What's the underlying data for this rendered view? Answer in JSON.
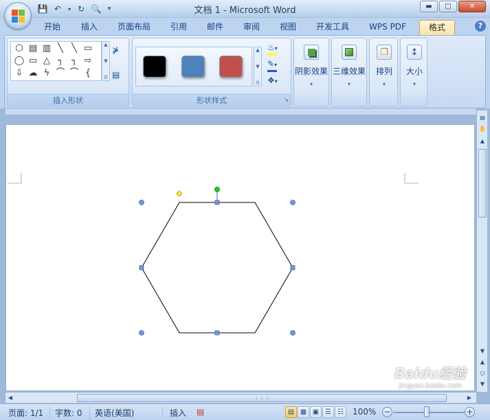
{
  "window": {
    "title": "文档 1 - Microsoft Word",
    "minimize_icon": "minimize-icon",
    "maximize_icon": "maximize-icon",
    "close_icon": "close-icon"
  },
  "quick_access": {
    "save_icon": "save-icon",
    "undo_icon": "undo-icon",
    "redo_icon": "redo-icon",
    "print_preview_icon": "print-preview-icon",
    "customize_icon": "customize-qat-icon"
  },
  "tabs": [
    {
      "label": "开始",
      "active": false
    },
    {
      "label": "插入",
      "active": false
    },
    {
      "label": "页面布局",
      "active": false
    },
    {
      "label": "引用",
      "active": false
    },
    {
      "label": "邮件",
      "active": false
    },
    {
      "label": "审阅",
      "active": false
    },
    {
      "label": "视图",
      "active": false
    },
    {
      "label": "开发工具",
      "active": false
    },
    {
      "label": "WPS PDF",
      "active": false
    },
    {
      "label": "格式",
      "active": true
    }
  ],
  "ribbon": {
    "insert_shapes": {
      "label": "插入形状",
      "shapes": [
        "⬡",
        "▤",
        "▥",
        "╲",
        "╲",
        "▭",
        "◯",
        "▭",
        "△",
        "┐",
        "┐",
        "⇨",
        "⇩",
        "☁",
        "ϟ",
        "⌒",
        "⌒",
        "{"
      ]
    },
    "shape_styles": {
      "label": "形状样式",
      "swatches": [
        "#000000",
        "#4f81bd",
        "#c0504d"
      ],
      "fill_icon": "fill-icon",
      "outline_icon": "outline-icon",
      "change_shape_icon": "change-shape-icon",
      "accent_fill": "#ffff00",
      "accent_outline": "#2b50d8"
    },
    "buttons": {
      "shadow_effects": "阴影效果",
      "three_d_effects": "三维效果",
      "arrange": "排列",
      "size": "大小"
    }
  },
  "document": {
    "selected_shape": "hexagon",
    "background": "#ffffff"
  },
  "statusbar": {
    "page": "页面: 1/1",
    "words": "字数: 0",
    "language": "英语(美国)",
    "mode": "插入",
    "zoom": "100%",
    "zoom_level": 1.0
  },
  "watermark": {
    "text": "Baidu经验",
    "sub": "jingyan.baidu.com"
  }
}
